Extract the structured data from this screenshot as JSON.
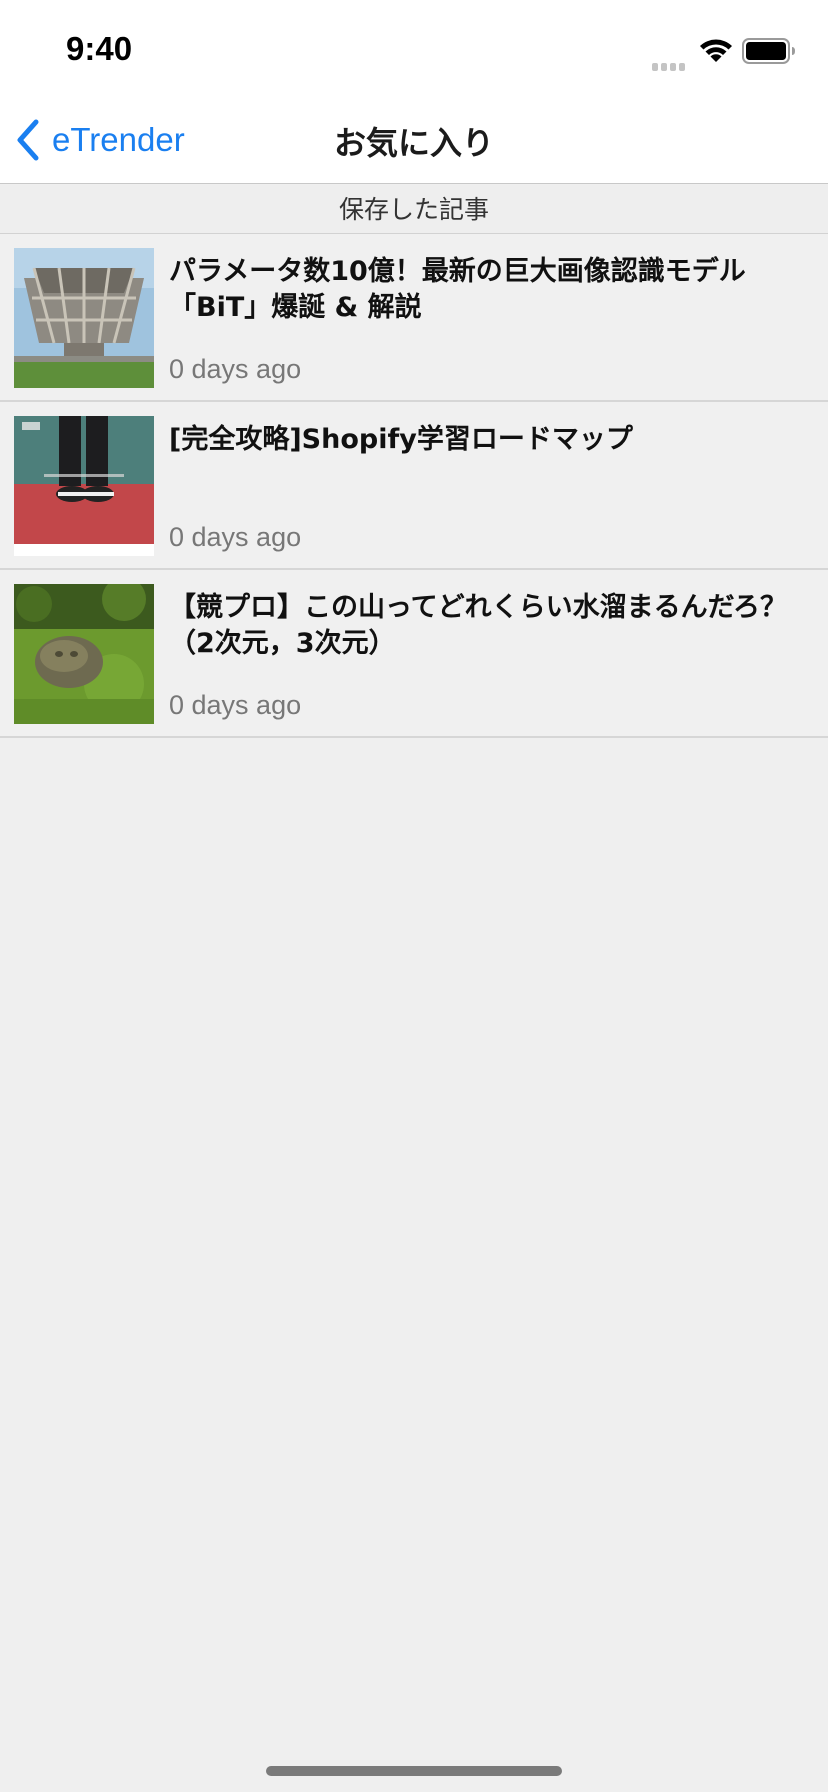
{
  "status_bar": {
    "time": "9:40",
    "icons": [
      "cellular-signal-icon",
      "wifi-icon",
      "battery-icon"
    ]
  },
  "nav": {
    "back_label": "eTrender",
    "title": "お気に入り",
    "accent_color": "#1a7ff0"
  },
  "section": {
    "header": "保存した記事"
  },
  "articles": [
    {
      "title_line1": "パラメータ数10億！最新の巨大画像認識モデル",
      "title_line2": "「BiT」爆誕 & 解説",
      "date": "0 days ago",
      "thumbnail": "building-photo"
    },
    {
      "title_line1": "[完全攻略]Shopify学習ロードマップ",
      "title_line2": "",
      "date": "0 days ago",
      "thumbnail": "shoes-on-court-photo"
    },
    {
      "title_line1": "【競プロ】この山ってどれくらい水溜まるんだろ？",
      "title_line2": "（2次元，3次元）",
      "date": "0 days ago",
      "thumbnail": "mossy-stone-photo"
    }
  ]
}
